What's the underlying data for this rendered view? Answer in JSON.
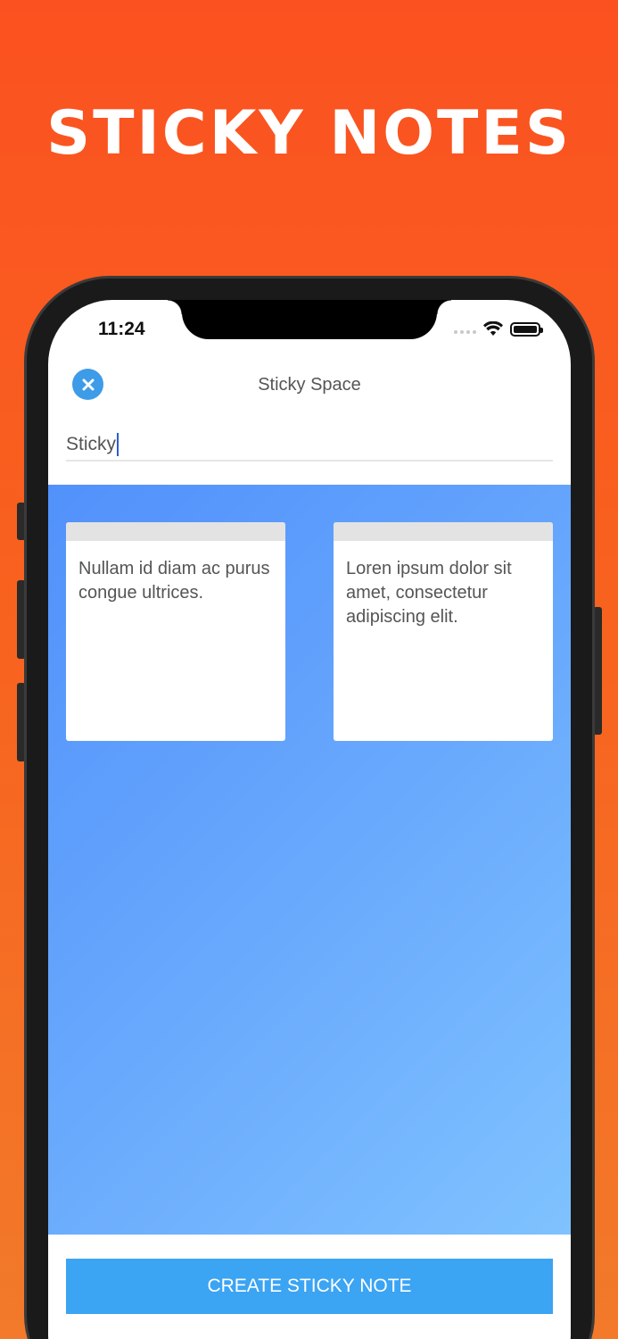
{
  "promo": {
    "title": "STICKY NOTES"
  },
  "status_bar": {
    "time": "11:24",
    "icons": [
      "signal-icon",
      "wifi-icon",
      "battery-icon"
    ]
  },
  "header": {
    "close_icon": "close-icon",
    "title": "Sticky Space"
  },
  "name_input": {
    "value": "Sticky"
  },
  "notes": [
    {
      "text": "Nullam id diam ac purus congue ultrices."
    },
    {
      "text": "Loren ipsum dolor sit amet, consectetur adipiscing elit."
    }
  ],
  "footer": {
    "create_label": "CREATE STICKY NOTE"
  },
  "colors": {
    "background": "#fb5120",
    "accent_blue": "#3ba4f3",
    "close_blue": "#3d9be8",
    "board_start": "#5191fb",
    "board_end": "#7fc2fe"
  }
}
